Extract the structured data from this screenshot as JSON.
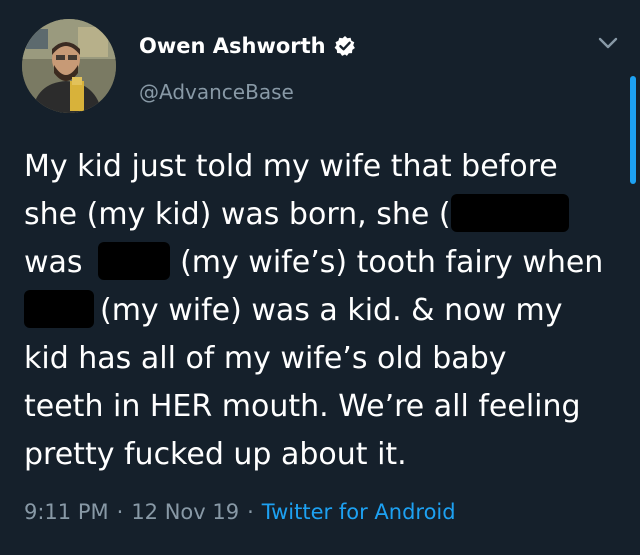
{
  "tweet": {
    "display_name": "Owen Ashworth",
    "handle": "@AdvanceBase",
    "verified": true,
    "avatar_icon": "profile-photo",
    "menu_icon": "chevron-down-icon",
    "body_lines": [
      {
        "before": "My kid just told my wife that before",
        "after": ""
      },
      {
        "before": "she (my kid) was born, she (",
        "after": ""
      },
      {
        "before": "was ",
        "after": "(my wife’s) tooth fairy when"
      },
      {
        "before": "",
        "after": "(my wife) was a kid. & now my"
      },
      {
        "before": "kid has all of my wife’s old baby",
        "after": ""
      },
      {
        "before": "teeth in HER mouth. We’re all feeling",
        "after": ""
      },
      {
        "before": "pretty fucked up about it.",
        "after": ""
      }
    ],
    "time": "9:11 PM",
    "date": "12 Nov 19",
    "separator": "·",
    "source": "Twitter for Android"
  },
  "colors": {
    "background": "#15202b",
    "text": "#ffffff",
    "secondary": "#8899a6",
    "accent": "#1da1f2",
    "redaction": "#000000"
  }
}
